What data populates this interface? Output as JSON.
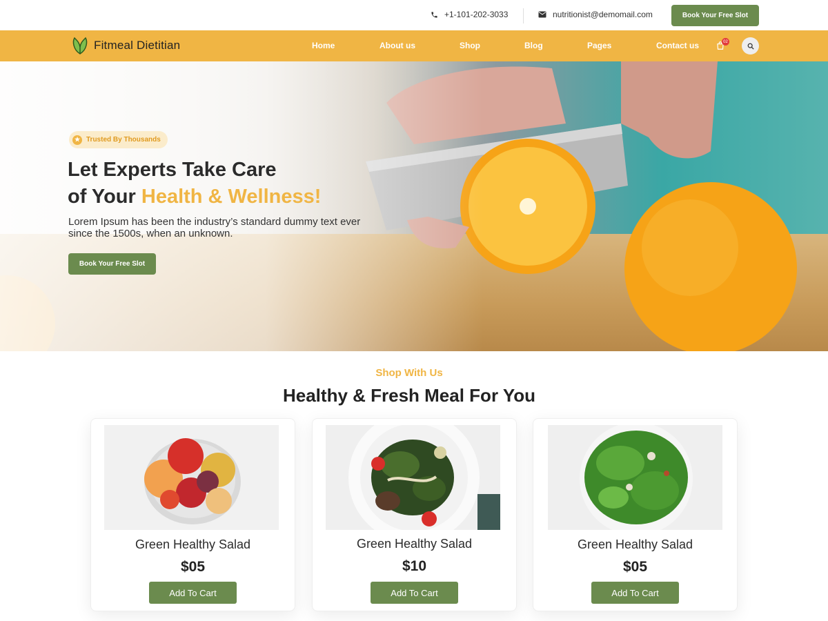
{
  "topbar": {
    "phone": "+1-101-202-3033",
    "email": "nutritionist@demomail.com",
    "cta": "Book Your Free Slot"
  },
  "brand": {
    "name": "Fitmeal Dietitian",
    "icon": "leaf-icon"
  },
  "nav": {
    "items": [
      "Home",
      "About us",
      "Shop",
      "Blog",
      "Pages",
      "Contact us"
    ],
    "cart_count": "02"
  },
  "hero": {
    "badge": "Trusted By Thousands",
    "title_line1": "Let Experts Take Care",
    "title_line2_prefix": "of Your ",
    "title_line2_accent": "Health & Wellness!",
    "description": "Lorem Ipsum has been the industry’s standard dummy text ever since the 1500s, when an unknown.",
    "cta": "Book Your Free Slot"
  },
  "shop": {
    "eyebrow": "Shop With Us",
    "title": "Healthy & Fresh Meal For You",
    "products": [
      {
        "name": "Green Healthy Salad",
        "price": "$05",
        "button": "Add To Cart"
      },
      {
        "name": "Green Healthy Salad",
        "price": "$10",
        "button": "Add To Cart"
      },
      {
        "name": "Green Healthy Salad",
        "price": "$05",
        "button": "Add To Cart"
      }
    ]
  },
  "colors": {
    "accent": "#f0b544",
    "primary": "#6b8b4e"
  }
}
